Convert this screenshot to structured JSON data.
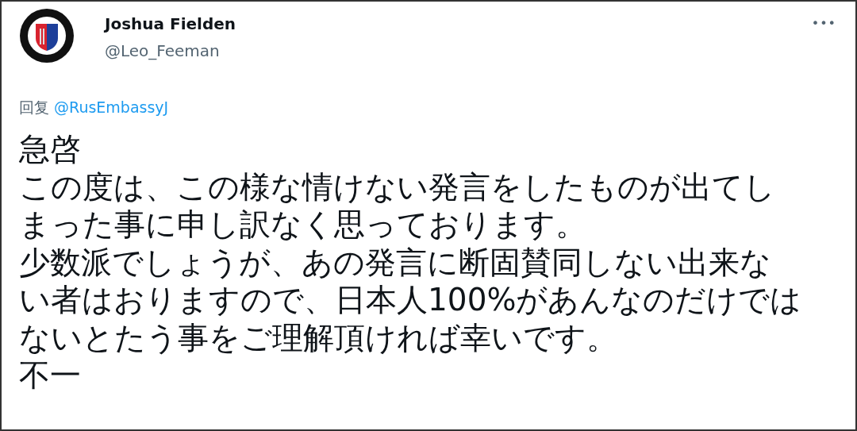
{
  "author": {
    "name": "Joshua Fielden",
    "handle": "@Leo_Feeman"
  },
  "more_button": {
    "label": "•••"
  },
  "reply": {
    "prefix": "回复",
    "mention": "@RusEmbassyJ"
  },
  "body_lines": [
    "急啓",
    "この度は、この様な情けない発言をしたものが出てし",
    "まった事に申し訳なく思っております。",
    "少数派でしょうが、あの発言に断固賛同しない出来な",
    "い者はおりますので、日本人100%があんなのだけでは",
    "ないとたう事をご理解頂ければ幸いです。",
    "不一"
  ]
}
